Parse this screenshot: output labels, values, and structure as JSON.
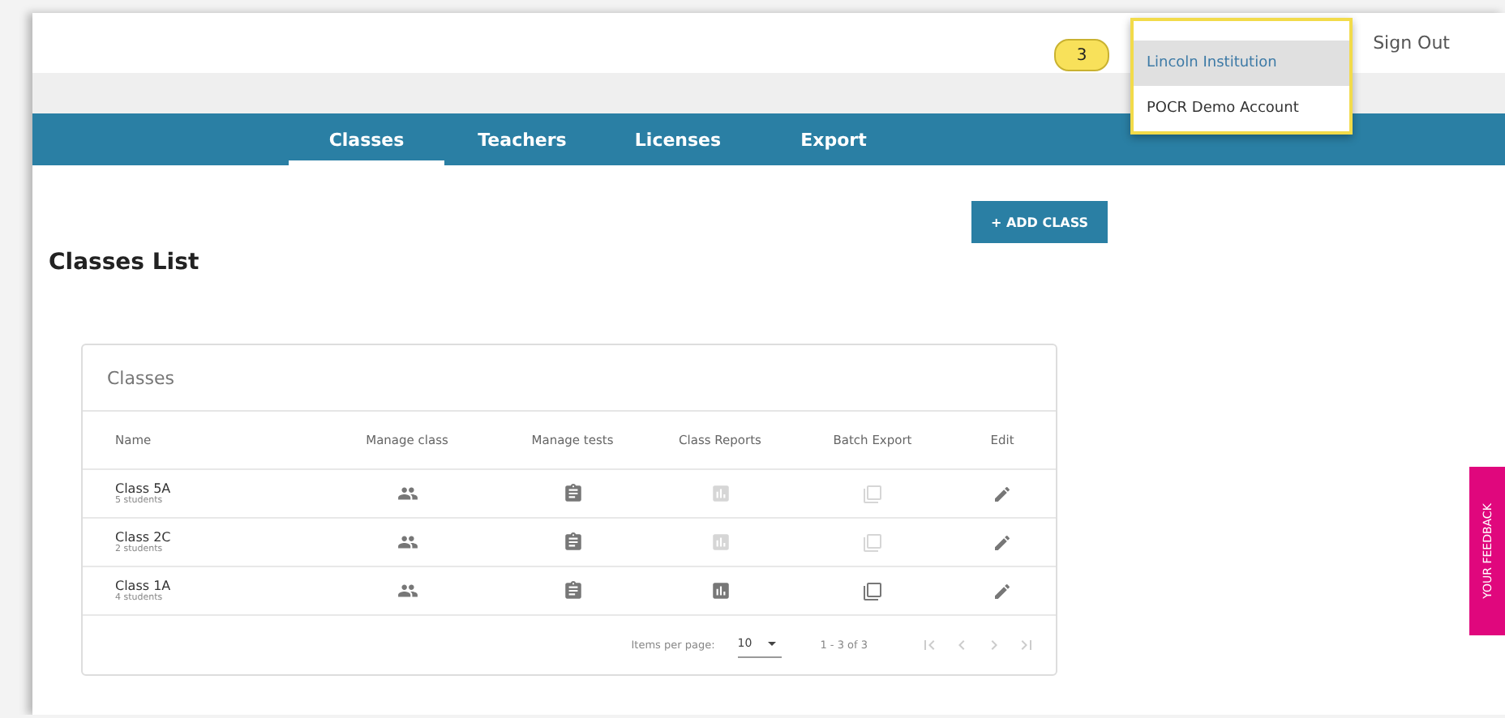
{
  "header": {
    "sign_out": "Sign Out"
  },
  "account_menu": {
    "callout": "3",
    "items": [
      {
        "label": "Lincoln Institution",
        "selected": true
      },
      {
        "label": "POCR Demo Account",
        "selected": false
      }
    ]
  },
  "tabs": [
    {
      "label": "Classes",
      "selected": true
    },
    {
      "label": "Teachers",
      "selected": false
    },
    {
      "label": "Licenses",
      "selected": false
    },
    {
      "label": "Export",
      "selected": false
    }
  ],
  "add_button": "+ ADD CLASS",
  "page_title": "Classes List",
  "table": {
    "title": "Classes",
    "columns": [
      "Name",
      "Manage class",
      "Manage tests",
      "Class Reports",
      "Batch Export",
      "Edit"
    ],
    "rows": [
      {
        "name": "Class 5A",
        "students": "5 students",
        "reports_enabled": false
      },
      {
        "name": "Class 2C",
        "students": "2 students",
        "reports_enabled": false
      },
      {
        "name": "Class 1A",
        "students": "4 students",
        "reports_enabled": true
      }
    ]
  },
  "pagination": {
    "items_per_page_label": "Items per page:",
    "page_size": "10",
    "range": "1 - 3 of 3"
  },
  "feedback_tab": "YOUR FEEDBACK"
}
